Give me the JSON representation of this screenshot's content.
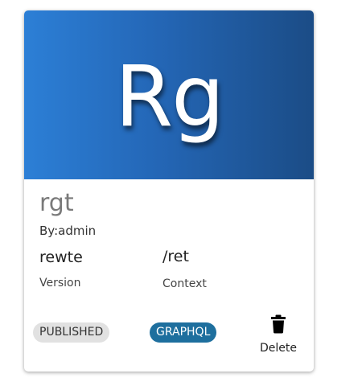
{
  "api_card": {
    "thumbnail_text": "Rg",
    "name": "rgt",
    "author": "By:admin",
    "version": {
      "value": "rewte",
      "label": "Version"
    },
    "context": {
      "value": "/ret",
      "label": "Context"
    },
    "badges": {
      "lifecycle": "PUBLISHED",
      "type": "GRAPHQL"
    },
    "delete_label": "Delete",
    "colors": {
      "thumbnail_gradient_start": "#2c7fd6",
      "thumbnail_gradient_end": "#1b4c86",
      "type_badge": "#1e6f9e",
      "lifecycle_badge": "#e1e1e1"
    },
    "icons": {
      "delete": "trash-icon"
    }
  }
}
